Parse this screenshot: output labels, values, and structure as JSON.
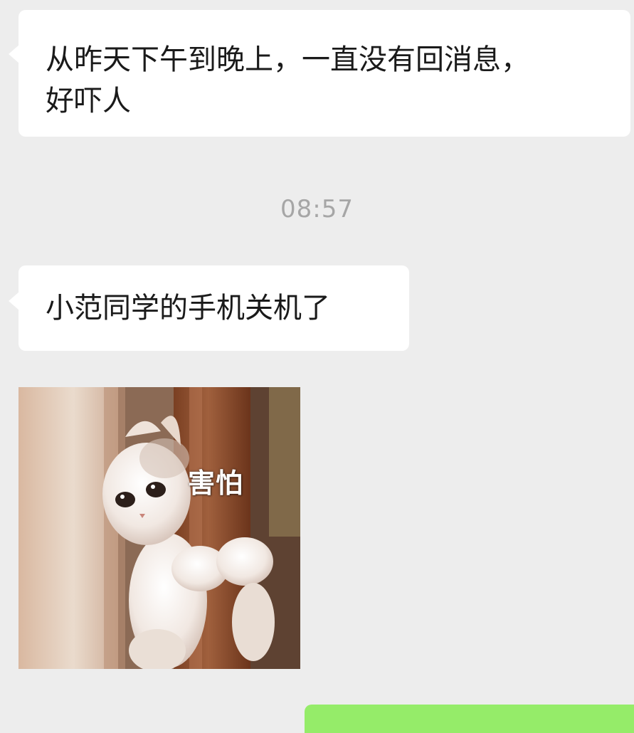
{
  "messages": [
    {
      "id": "msg1",
      "text": "从昨天下午到晚上，一直没有回消息，好吓人",
      "line1": "从昨天下午到晚上，一直没有回消息，",
      "line2": "好吓人"
    },
    {
      "id": "msg2",
      "text": "小范同学的手机关机了"
    }
  ],
  "timestamp": "08:57",
  "sticker": {
    "caption": "害怕",
    "icon": "cat-hugging-pole-sticker"
  },
  "colors": {
    "background": "#ededed",
    "incoming_bubble": "#ffffff",
    "outgoing_bubble": "#95ec69",
    "timestamp_text": "#a6a6a6"
  }
}
